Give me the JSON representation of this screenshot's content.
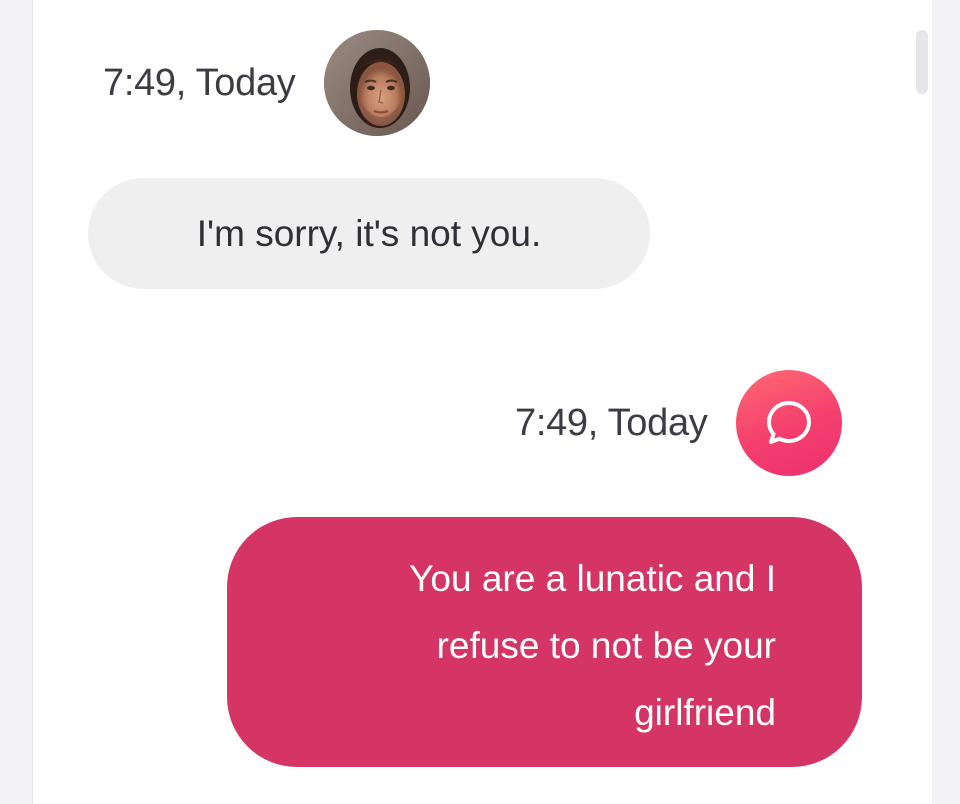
{
  "conversation": {
    "incoming": {
      "time": "7:49, Today",
      "avatar": "user-photo",
      "text": "I'm sorry, it's not you."
    },
    "outgoing": {
      "time": "7:49, Today",
      "avatar_icon": "chat-bubble-icon",
      "lines": [
        "You are a lunatic and I",
        "refuse to not be your",
        "girlfriend"
      ]
    }
  },
  "colors": {
    "outgoing_bubble": "#d43565",
    "incoming_bubble": "#efefef",
    "app_avatar_gradient": [
      "#ff6a72",
      "#ee2f6e"
    ]
  }
}
